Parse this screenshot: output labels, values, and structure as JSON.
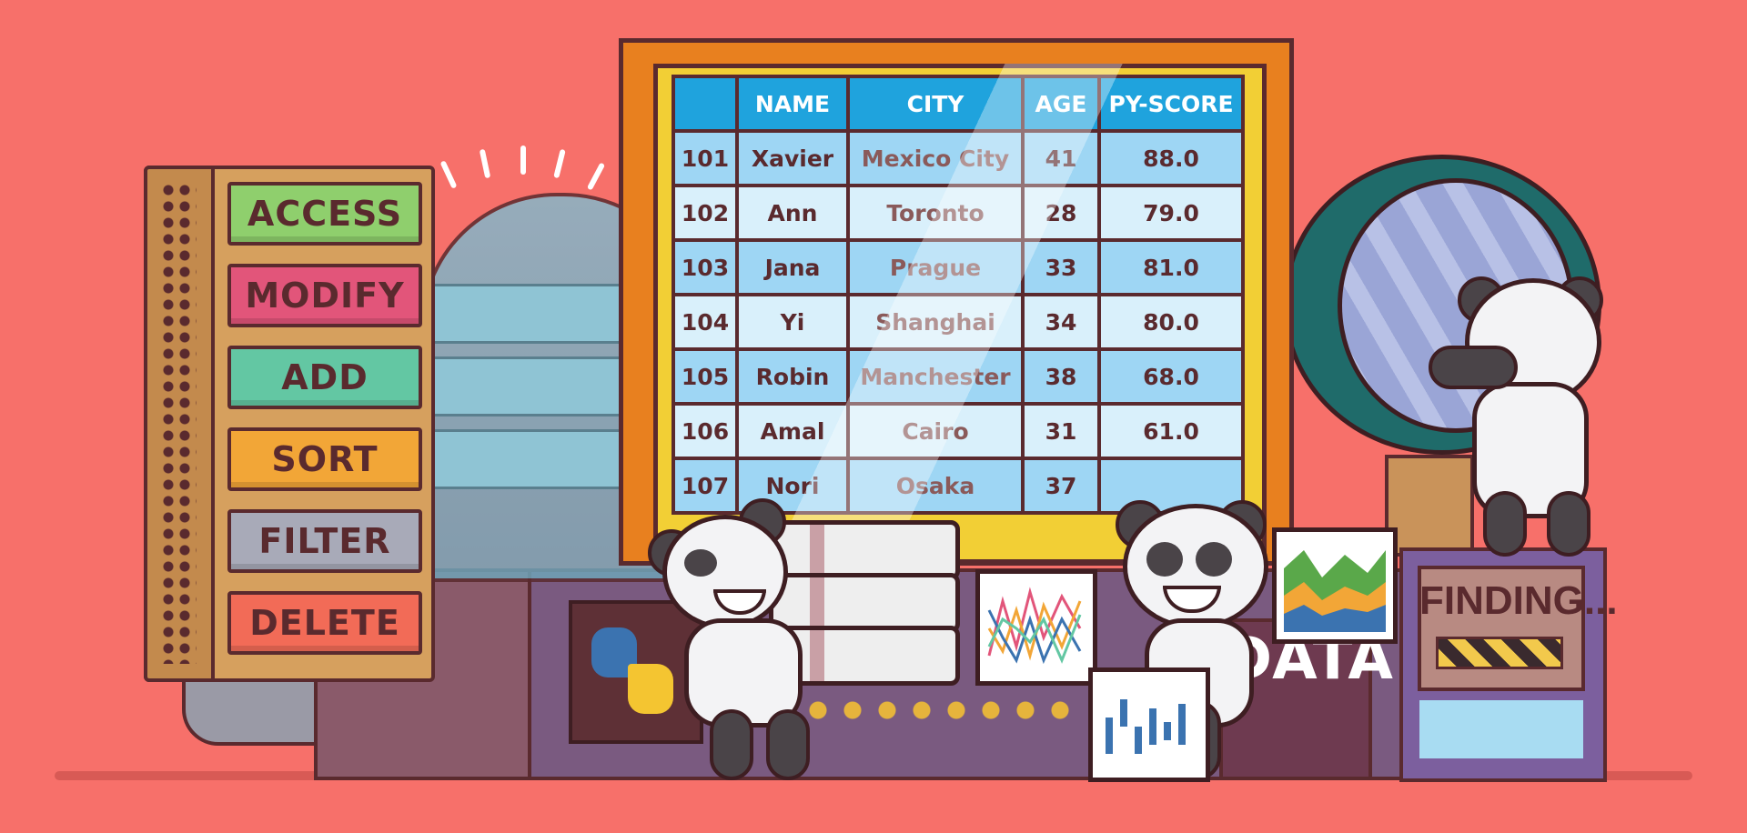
{
  "menu": {
    "buttons": [
      {
        "label": "ACCESS",
        "color": "#8fcf6d"
      },
      {
        "label": "MODIFY",
        "color": "#e2557a"
      },
      {
        "label": "ADD",
        "color": "#63c7a3"
      },
      {
        "label": "SORT",
        "color": "#f2a637"
      },
      {
        "label": "FILTER",
        "color": "#a8aab8"
      },
      {
        "label": "DELETE",
        "color": "#f26b57"
      }
    ]
  },
  "table": {
    "headers": [
      "",
      "NAME",
      "CITY",
      "AGE",
      "PY-SCORE"
    ],
    "rows": [
      [
        "101",
        "Xavier",
        "Mexico City",
        "41",
        "88.0"
      ],
      [
        "102",
        "Ann",
        "Toronto",
        "28",
        "79.0"
      ],
      [
        "103",
        "Jana",
        "Prague",
        "33",
        "81.0"
      ],
      [
        "104",
        "Yi",
        "Shanghai",
        "34",
        "80.0"
      ],
      [
        "105",
        "Robin",
        "Manchester",
        "38",
        "68.0"
      ],
      [
        "106",
        "Amal",
        "Cairo",
        "31",
        "61.0"
      ],
      [
        "107",
        "Nori",
        "Osaka",
        "37",
        ""
      ]
    ]
  },
  "labels": {
    "data": "DATA",
    "finding": "FINDING..."
  },
  "icons": {
    "python": "python-logo-icon",
    "database": "database-stack-icon",
    "magnifier": "magnifying-glass-icon"
  },
  "colors": {
    "background": "#f7706a",
    "outline": "#5a2a2e",
    "header_blue": "#1fa3dd",
    "monitor_frame": "#e8801f",
    "monitor_border": "#f2cf35"
  }
}
